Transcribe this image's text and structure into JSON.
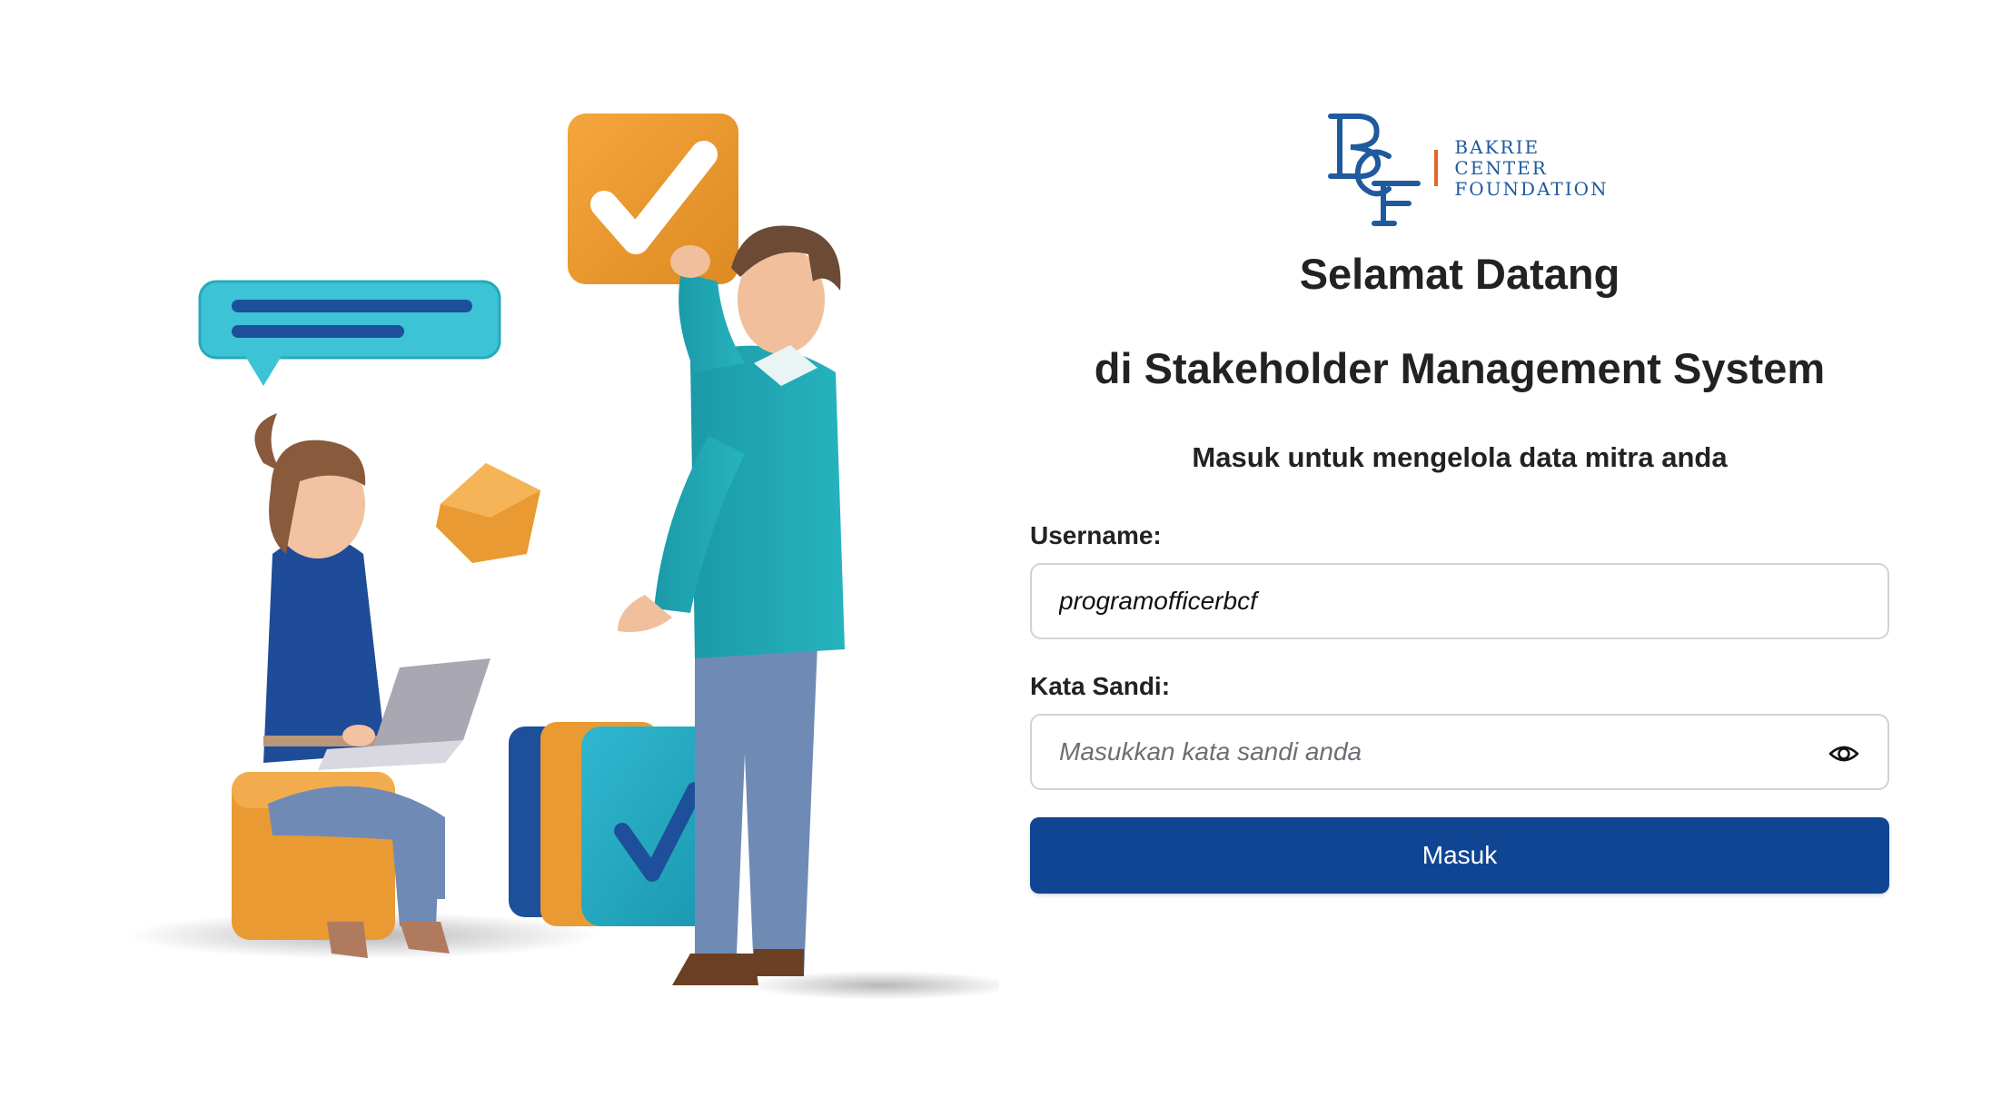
{
  "brand": {
    "logo_line1": "BAKRIE",
    "logo_line2": "CENTER",
    "logo_line3": "FOUNDATION",
    "logo_color": "#1f5a9e",
    "divider_color": "#e2652a"
  },
  "header": {
    "title": "Selamat Datang",
    "subtitle": "di Stakeholder Management System",
    "tagline": "Masuk untuk mengelola data mitra anda"
  },
  "form": {
    "username_label": "Username:",
    "username_value": "programofficerbcf",
    "password_label": "Kata Sandi:",
    "password_placeholder": "Masukkan kata sandi anda",
    "password_toggle_icon": "eye-icon",
    "submit_label": "Masuk",
    "submit_color": "#0f4592"
  },
  "illustration": {
    "speech_bubble_icon": "chat-bubble-icon",
    "checkbox_icon": "check-icon"
  }
}
